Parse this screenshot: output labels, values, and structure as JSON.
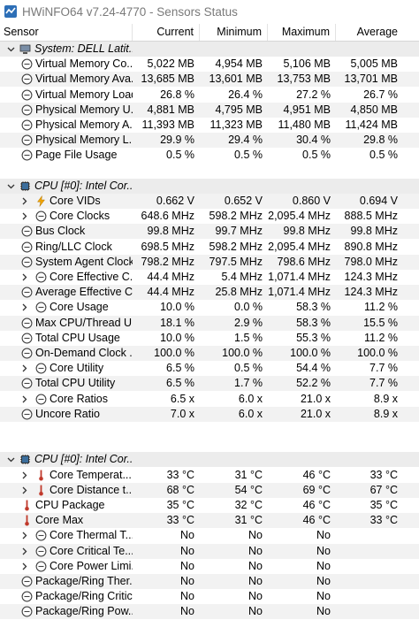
{
  "window": {
    "title": "HWiNFO64 v7.24-4770 - Sensors Status"
  },
  "columns": [
    "Sensor",
    "Current",
    "Minimum",
    "Maximum",
    "Average"
  ],
  "rows": [
    {
      "type": "group",
      "expander": "v",
      "name": "System: DELL Latit...",
      "icon": "computer",
      "indent": 0
    },
    {
      "type": "sensor",
      "expander": "",
      "name": "Virtual Memory Co...",
      "icon": "clock",
      "indent": 0,
      "values": [
        "5,022 MB",
        "4,954 MB",
        "5,106 MB",
        "5,005 MB"
      ]
    },
    {
      "type": "sensor",
      "expander": "",
      "name": "Virtual Memory Ava...",
      "icon": "clock",
      "indent": 0,
      "values": [
        "13,685 MB",
        "13,601 MB",
        "13,753 MB",
        "13,701 MB"
      ]
    },
    {
      "type": "sensor",
      "expander": "",
      "name": "Virtual Memory Load",
      "icon": "clock",
      "indent": 0,
      "values": [
        "26.8 %",
        "26.4 %",
        "27.2 %",
        "26.7 %"
      ]
    },
    {
      "type": "sensor",
      "expander": "",
      "name": "Physical Memory U...",
      "icon": "clock",
      "indent": 0,
      "values": [
        "4,881 MB",
        "4,795 MB",
        "4,951 MB",
        "4,850 MB"
      ]
    },
    {
      "type": "sensor",
      "expander": "",
      "name": "Physical Memory A...",
      "icon": "clock",
      "indent": 0,
      "values": [
        "11,393 MB",
        "11,323 MB",
        "11,480 MB",
        "11,424 MB"
      ]
    },
    {
      "type": "sensor",
      "expander": "",
      "name": "Physical Memory L...",
      "icon": "clock",
      "indent": 0,
      "values": [
        "29.9 %",
        "29.4 %",
        "30.4 %",
        "29.8 %"
      ]
    },
    {
      "type": "sensor",
      "expander": "",
      "name": "Page File Usage",
      "icon": "clock",
      "indent": 0,
      "values": [
        "0.5 %",
        "0.5 %",
        "0.5 %",
        "0.5 %"
      ]
    },
    {
      "type": "blank"
    },
    {
      "type": "group",
      "expander": "v",
      "name": "CPU [#0]: Intel Cor...",
      "icon": "chip",
      "indent": 0
    },
    {
      "type": "sensor",
      "expander": ">",
      "name": "Core VIDs",
      "icon": "bolt",
      "indent": 1,
      "values": [
        "0.662 V",
        "0.652 V",
        "0.860 V",
        "0.694 V"
      ]
    },
    {
      "type": "sensor",
      "expander": ">",
      "name": "Core Clocks",
      "icon": "clock",
      "indent": 1,
      "values": [
        "648.6 MHz",
        "598.2 MHz",
        "2,095.4 MHz",
        "888.5 MHz"
      ]
    },
    {
      "type": "sensor",
      "expander": "",
      "name": "Bus Clock",
      "icon": "clock",
      "indent": 0,
      "values": [
        "99.8 MHz",
        "99.7 MHz",
        "99.8 MHz",
        "99.8 MHz"
      ]
    },
    {
      "type": "sensor",
      "expander": "",
      "name": "Ring/LLC Clock",
      "icon": "clock",
      "indent": 0,
      "values": [
        "698.5 MHz",
        "598.2 MHz",
        "2,095.4 MHz",
        "890.8 MHz"
      ]
    },
    {
      "type": "sensor",
      "expander": "",
      "name": "System Agent Clock",
      "icon": "clock",
      "indent": 0,
      "values": [
        "798.2 MHz",
        "797.5 MHz",
        "798.6 MHz",
        "798.0 MHz"
      ]
    },
    {
      "type": "sensor",
      "expander": ">",
      "name": "Core Effective C...",
      "icon": "clock",
      "indent": 1,
      "values": [
        "44.4 MHz",
        "5.4 MHz",
        "1,071.4 MHz",
        "124.3 MHz"
      ]
    },
    {
      "type": "sensor",
      "expander": "",
      "name": "Average Effective C...",
      "icon": "clock",
      "indent": 0,
      "values": [
        "44.4 MHz",
        "25.8 MHz",
        "1,071.4 MHz",
        "124.3 MHz"
      ]
    },
    {
      "type": "sensor",
      "expander": ">",
      "name": "Core Usage",
      "icon": "clock",
      "indent": 1,
      "values": [
        "10.0 %",
        "0.0 %",
        "58.3 %",
        "11.2 %"
      ]
    },
    {
      "type": "sensor",
      "expander": "",
      "name": "Max CPU/Thread U...",
      "icon": "clock",
      "indent": 0,
      "values": [
        "18.1 %",
        "2.9 %",
        "58.3 %",
        "15.5 %"
      ]
    },
    {
      "type": "sensor",
      "expander": "",
      "name": "Total CPU Usage",
      "icon": "clock",
      "indent": 0,
      "values": [
        "10.0 %",
        "1.5 %",
        "55.3 %",
        "11.2 %"
      ]
    },
    {
      "type": "sensor",
      "expander": "",
      "name": "On-Demand Clock ...",
      "icon": "clock",
      "indent": 0,
      "values": [
        "100.0 %",
        "100.0 %",
        "100.0 %",
        "100.0 %"
      ]
    },
    {
      "type": "sensor",
      "expander": ">",
      "name": "Core Utility",
      "icon": "clock",
      "indent": 1,
      "values": [
        "6.5 %",
        "0.5 %",
        "54.4 %",
        "7.7 %"
      ]
    },
    {
      "type": "sensor",
      "expander": "",
      "name": "Total CPU Utility",
      "icon": "clock",
      "indent": 0,
      "values": [
        "6.5 %",
        "1.7 %",
        "52.2 %",
        "7.7 %"
      ]
    },
    {
      "type": "sensor",
      "expander": ">",
      "name": "Core Ratios",
      "icon": "clock",
      "indent": 1,
      "values": [
        "6.5 x",
        "6.0 x",
        "21.0 x",
        "8.9 x"
      ]
    },
    {
      "type": "sensor",
      "expander": "",
      "name": "Uncore Ratio",
      "icon": "clock",
      "indent": 0,
      "values": [
        "7.0 x",
        "6.0 x",
        "21.0 x",
        "8.9 x"
      ]
    },
    {
      "type": "blank"
    },
    {
      "type": "blank"
    },
    {
      "type": "group",
      "expander": "v",
      "name": "CPU [#0]: Intel Cor...",
      "icon": "chip",
      "indent": 0
    },
    {
      "type": "sensor",
      "expander": ">",
      "name": "Core Temperat...",
      "icon": "thermo",
      "indent": 1,
      "values": [
        "33 °C",
        "31 °C",
        "46 °C",
        "33 °C"
      ]
    },
    {
      "type": "sensor",
      "expander": ">",
      "name": "Core Distance t...",
      "icon": "thermo",
      "indent": 1,
      "values": [
        "68 °C",
        "54 °C",
        "69 °C",
        "67 °C"
      ]
    },
    {
      "type": "sensor",
      "expander": "",
      "name": "CPU Package",
      "icon": "thermo",
      "indent": 0,
      "values": [
        "35 °C",
        "32 °C",
        "46 °C",
        "35 °C"
      ]
    },
    {
      "type": "sensor",
      "expander": "",
      "name": "Core Max",
      "icon": "thermo",
      "indent": 0,
      "values": [
        "33 °C",
        "31 °C",
        "46 °C",
        "33 °C"
      ]
    },
    {
      "type": "sensor",
      "expander": ">",
      "name": "Core Thermal T...",
      "icon": "clock",
      "indent": 1,
      "values": [
        "No",
        "No",
        "No",
        ""
      ]
    },
    {
      "type": "sensor",
      "expander": ">",
      "name": "Core Critical Te...",
      "icon": "clock",
      "indent": 1,
      "values": [
        "No",
        "No",
        "No",
        ""
      ]
    },
    {
      "type": "sensor",
      "expander": ">",
      "name": "Core Power Limi...",
      "icon": "clock",
      "indent": 1,
      "values": [
        "No",
        "No",
        "No",
        ""
      ]
    },
    {
      "type": "sensor",
      "expander": "",
      "name": "Package/Ring Ther...",
      "icon": "clock",
      "indent": 0,
      "values": [
        "No",
        "No",
        "No",
        ""
      ]
    },
    {
      "type": "sensor",
      "expander": "",
      "name": "Package/Ring Critic...",
      "icon": "clock",
      "indent": 0,
      "values": [
        "No",
        "No",
        "No",
        ""
      ]
    },
    {
      "type": "sensor",
      "expander": "",
      "name": "Package/Ring Pow...",
      "icon": "clock",
      "indent": 0,
      "values": [
        "No",
        "No",
        "No",
        ""
      ]
    },
    {
      "type": "blank"
    }
  ],
  "colors": {
    "altRow": "#f2f2f2",
    "groupRow": "#ececec",
    "thermo": "#c0392b",
    "bolt": "#f0a500",
    "clockStroke": "#444444"
  }
}
